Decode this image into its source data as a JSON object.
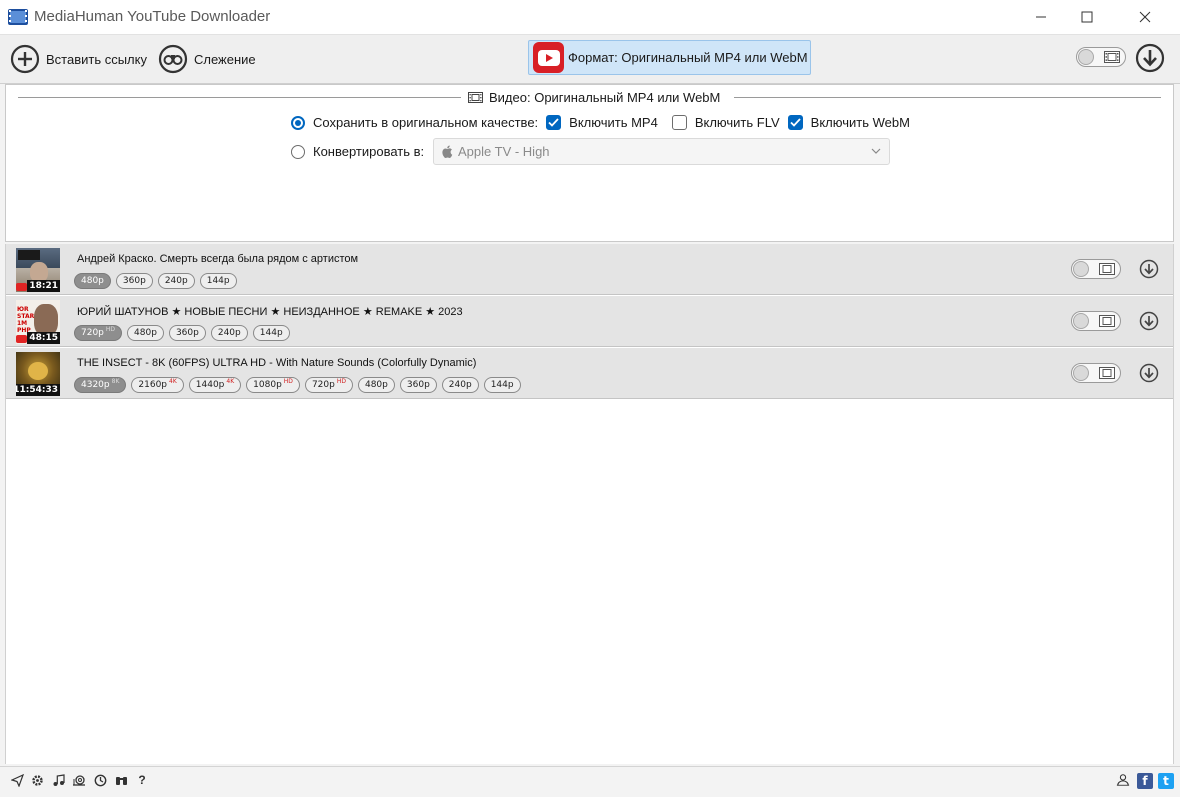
{
  "window": {
    "title": "MediaHuman YouTube Downloader"
  },
  "toolbar": {
    "paste_label": "Вставить ссылку",
    "track_label": "Слежение",
    "format_label": "Формат: Оригинальный MP4 или WebM"
  },
  "panel": {
    "header": "Видео: Оригинальный MP4 или WebM",
    "save_original_label": "Сохранить в оригинальном качестве:",
    "include_mp4_label": "Включить MP4",
    "include_flv_label": "Включить FLV",
    "include_webm_label": "Включить WebM",
    "convert_label": "Конвертировать в:",
    "convert_selected": "Apple TV - High",
    "save_original_selected": true,
    "include_mp4": true,
    "include_flv": false,
    "include_webm": true
  },
  "videos": [
    {
      "title": "Андрей Краско. Смерть всегда была рядом с артистом",
      "duration": "18:21",
      "qualities": [
        {
          "label": "480p",
          "tag": "",
          "selected": true
        },
        {
          "label": "360p",
          "tag": "",
          "selected": false
        },
        {
          "label": "240p",
          "tag": "",
          "selected": false
        },
        {
          "label": "144p",
          "tag": "",
          "selected": false
        }
      ]
    },
    {
      "title": "ЮРИЙ ШАТУНОВ ★ НОВЫЕ ПЕСНИ ★ НЕИЗДАННОЕ ★ REMAKE ★ 2023",
      "duration": "48:15",
      "qualities": [
        {
          "label": "720p",
          "tag": "HD",
          "selected": true
        },
        {
          "label": "480p",
          "tag": "",
          "selected": false
        },
        {
          "label": "360p",
          "tag": "",
          "selected": false
        },
        {
          "label": "240p",
          "tag": "",
          "selected": false
        },
        {
          "label": "144p",
          "tag": "",
          "selected": false
        }
      ]
    },
    {
      "title": "THE INSECT - 8K (60FPS) ULTRA HD - With Nature Sounds (Colorfully Dynamic)",
      "duration": "11:54:33",
      "qualities": [
        {
          "label": "4320p",
          "tag": "8K",
          "selected": true
        },
        {
          "label": "2160p",
          "tag": "4K",
          "selected": false
        },
        {
          "label": "1440p",
          "tag": "4K",
          "selected": false
        },
        {
          "label": "1080p",
          "tag": "HD",
          "selected": false
        },
        {
          "label": "720p",
          "tag": "HD",
          "selected": false
        },
        {
          "label": "480p",
          "tag": "",
          "selected": false
        },
        {
          "label": "360p",
          "tag": "",
          "selected": false
        },
        {
          "label": "240p",
          "tag": "",
          "selected": false
        },
        {
          "label": "144p",
          "tag": "",
          "selected": false
        }
      ]
    }
  ],
  "statusbar": {
    "left_icons": [
      "send-icon",
      "gear-icon",
      "music-icon",
      "snail-icon",
      "clock-icon",
      "binoculars-icon",
      "help-icon"
    ],
    "right_icons": [
      "user-group-icon",
      "facebook-icon",
      "twitter-icon"
    ],
    "help_glyph": "?",
    "facebook_glyph": "f",
    "twitter_glyph": "t"
  },
  "colors": {
    "accent": "#0067c0",
    "youtube_red": "#d81f26",
    "format_bg": "#cfe5f8",
    "row_bg": "#e4e4e4"
  }
}
